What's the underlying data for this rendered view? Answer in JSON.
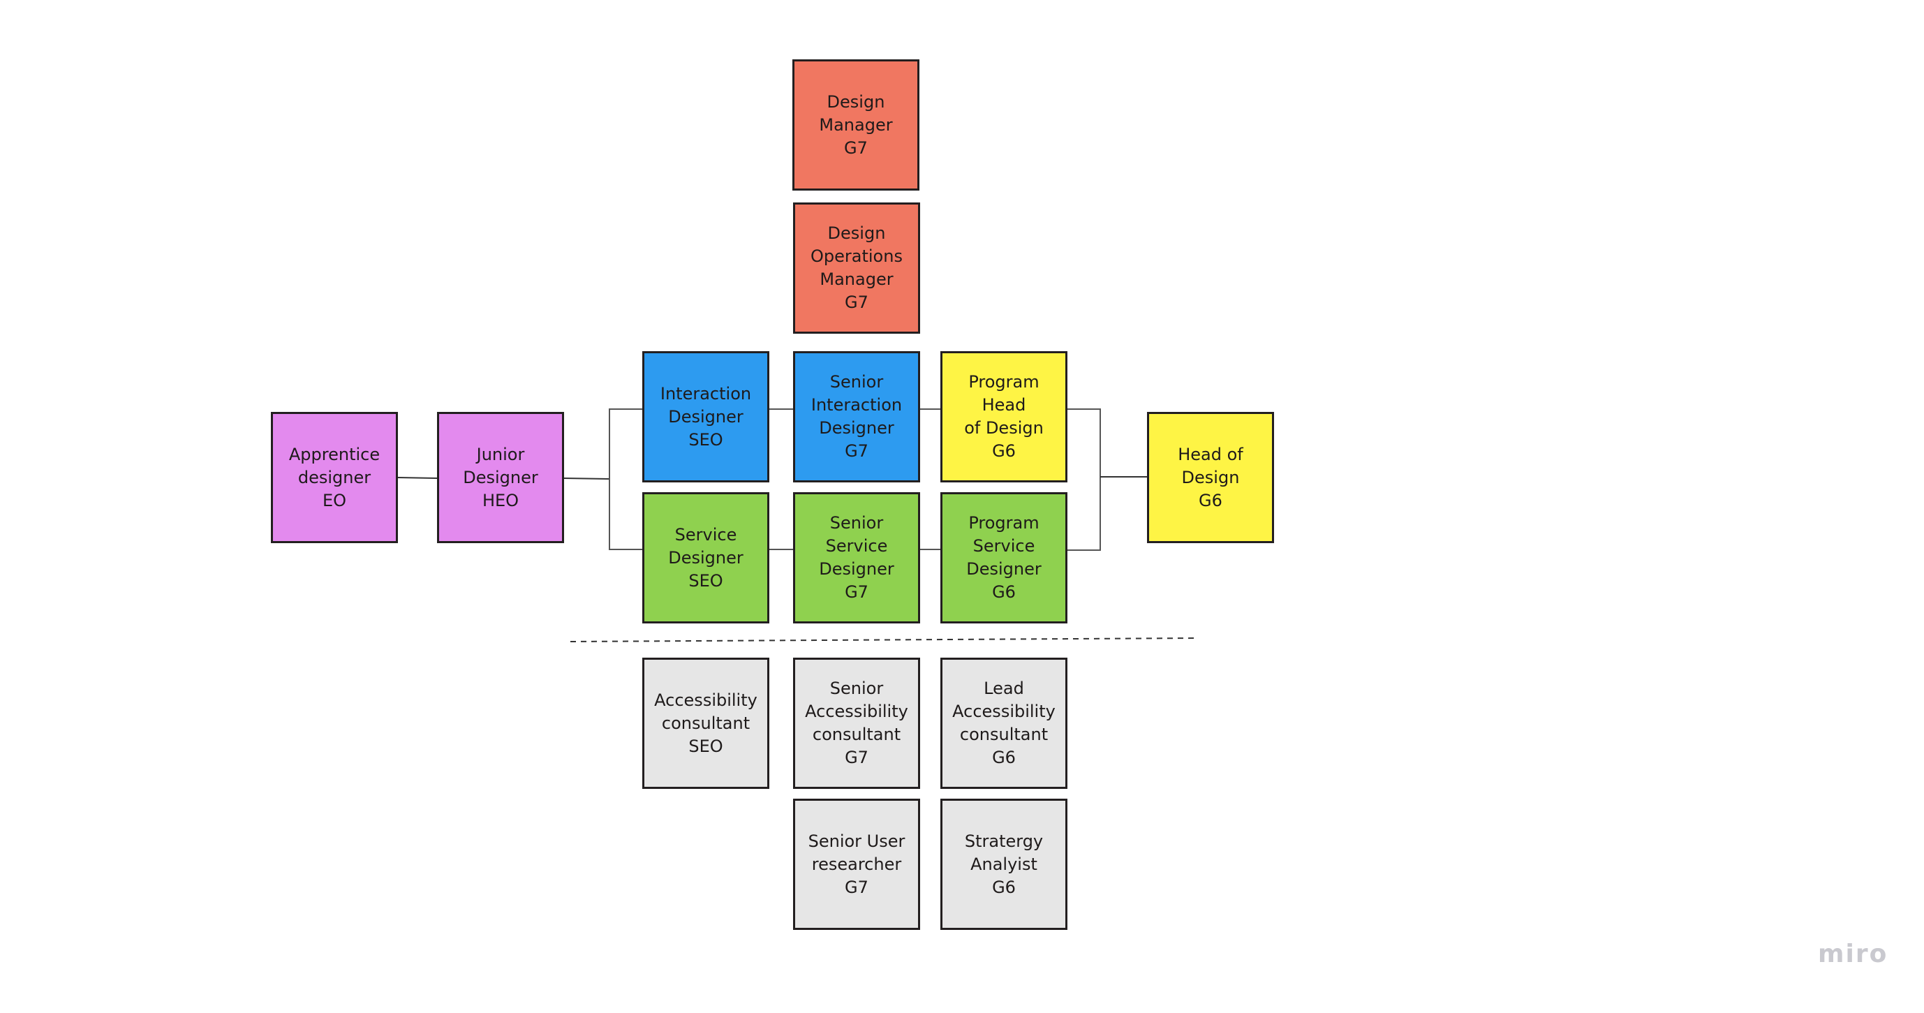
{
  "colors": {
    "management": "#f07761",
    "interaction": "#2d9bf0",
    "leadership": "#fef445",
    "service": "#8fd14f",
    "entry": "#e38aee",
    "specialist": "#e6e6e6"
  },
  "cards": {
    "design_manager": "Design\nManager\nG7",
    "design_ops_manager": "Design\nOperations\nManager\nG7",
    "apprentice": "Apprentice\ndesigner\nEO",
    "junior": "Junior\nDesigner\nHEO",
    "interaction_designer": "Interaction\nDesigner\nSEO",
    "senior_interaction": "Senior\nInteraction\nDesigner\nG7",
    "program_head": "Program Head\nof Design\nG6",
    "head_of_design": "Head of\nDesign\nG6",
    "service_designer": "Service\nDesigner\nSEO",
    "senior_service": "Senior\nService\nDesigner\nG7",
    "program_service": "Program\nService\nDesigner\nG6",
    "accessibility": "Accessibility\nconsultant\nSEO",
    "senior_accessibility": "Senior\nAccessibility\nconsultant\nG7",
    "lead_accessibility": "Lead\nAccessibility\nconsultant\nG6",
    "senior_user_researcher": "Senior User\nresearcher\nG7",
    "strategy_analyst": "Stratergy\nAnalyist\nG6"
  },
  "branding": {
    "logo": "miro"
  }
}
